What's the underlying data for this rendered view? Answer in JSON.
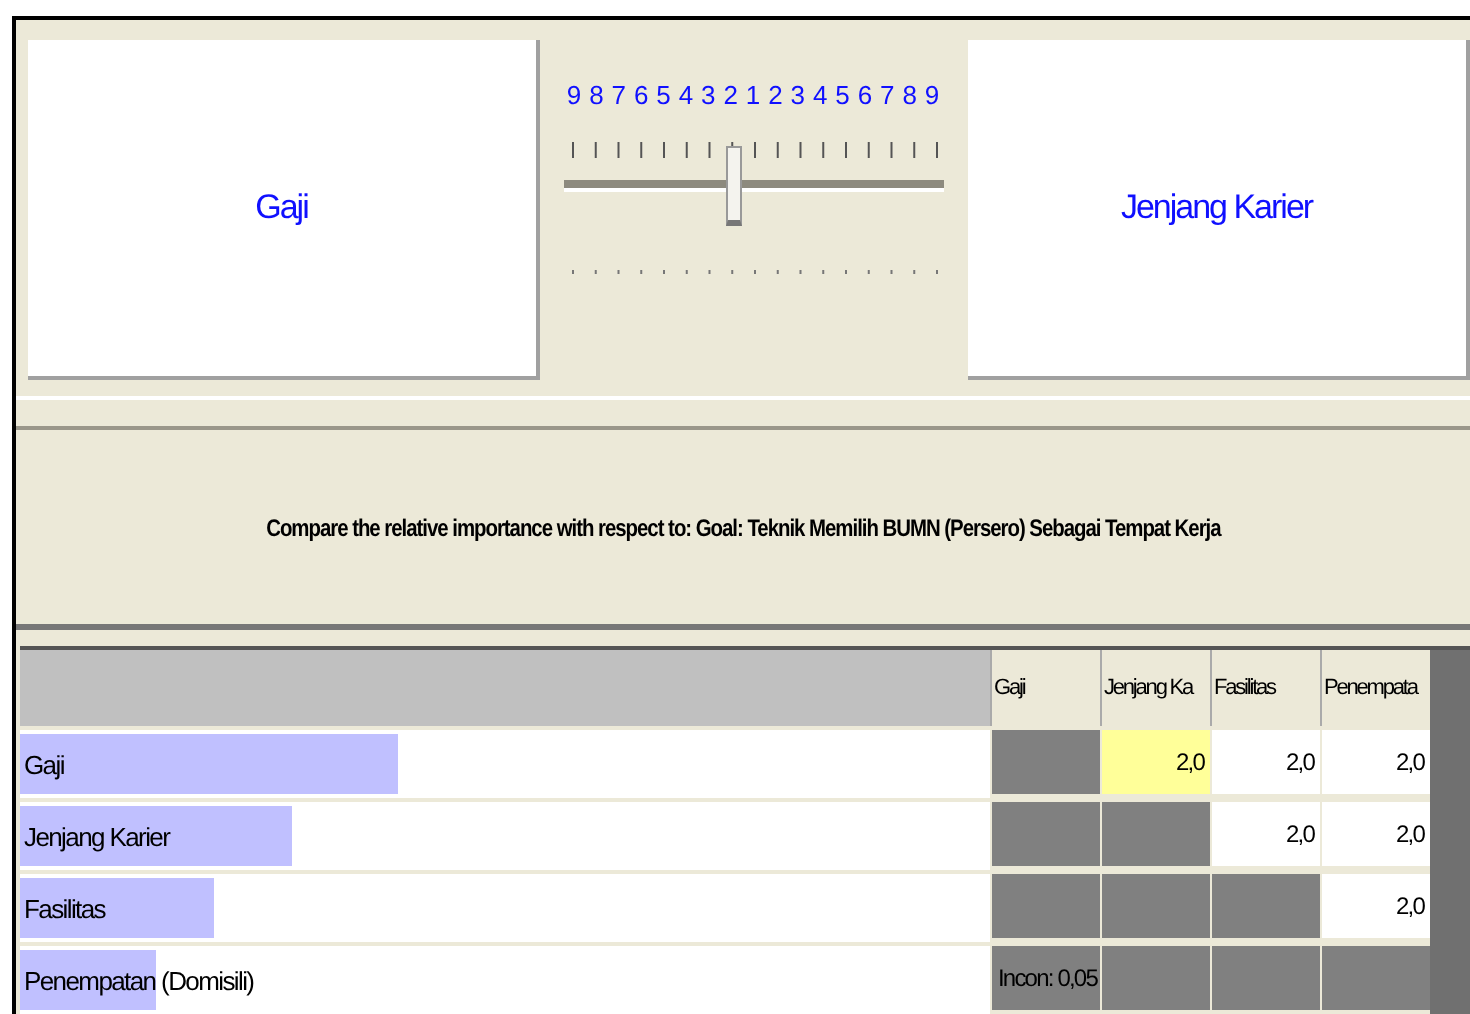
{
  "left_item": "Gaji",
  "right_item": "Jenjang Karier",
  "scale": {
    "labels": [
      "9",
      "8",
      "7",
      "6",
      "5",
      "4",
      "3",
      "2",
      "1",
      "2",
      "3",
      "4",
      "5",
      "6",
      "7",
      "8",
      "9"
    ],
    "level": 0.4375
  },
  "prompt": "Compare the relative importance with respect to: Goal: Teknik Memilih BUMN (Persero) Sebagai Tempat Kerja",
  "table": {
    "columns": [
      "Gaji",
      "Jenjang Ka",
      "Fasilitas",
      "Penempata"
    ],
    "rows": [
      {
        "label": "Gaji",
        "level": 0.39,
        "cells": [
          {
            "kind": "blank"
          },
          {
            "kind": "value",
            "text": "2,0",
            "selected": true
          },
          {
            "kind": "value",
            "text": "2,0",
            "selected": false
          },
          {
            "kind": "value",
            "text": "2,0",
            "selected": false
          }
        ]
      },
      {
        "label": "Jenjang Karier",
        "level": 0.28,
        "cells": [
          {
            "kind": "blank"
          },
          {
            "kind": "blank"
          },
          {
            "kind": "value",
            "text": "2,0",
            "selected": false
          },
          {
            "kind": "value",
            "text": "2,0",
            "selected": false
          }
        ]
      },
      {
        "label": "Fasilitas",
        "level": 0.2,
        "cells": [
          {
            "kind": "blank"
          },
          {
            "kind": "blank"
          },
          {
            "kind": "blank"
          },
          {
            "kind": "value",
            "text": "2,0",
            "selected": false
          }
        ]
      },
      {
        "label": "Penempatan (Domisili)",
        "level": 0.14,
        "cells": [
          {
            "kind": "note",
            "text": "Incon: 0,05"
          },
          {
            "kind": "blank"
          },
          {
            "kind": "blank"
          },
          {
            "kind": "blank"
          }
        ]
      }
    ]
  }
}
